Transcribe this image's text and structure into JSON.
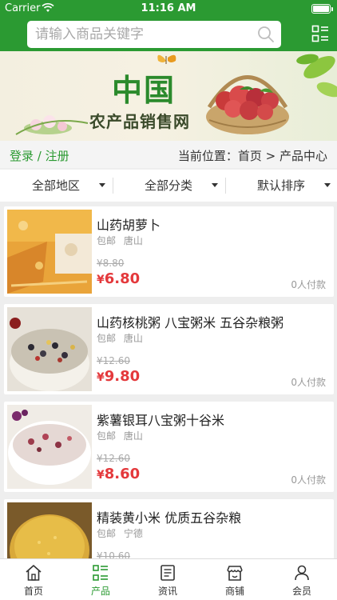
{
  "status_bar": {
    "carrier": "Carrier",
    "time": "11:16 AM"
  },
  "header": {
    "search_placeholder": "请输入商品关键字",
    "search_icon": "search-icon",
    "menu_icon": "grid-list-icon"
  },
  "banner": {
    "title": "中国",
    "subtitle": "农产品销售网"
  },
  "breadcrumb": {
    "login": "登录",
    "separator": "/",
    "register": "注册",
    "location": "当前位置：首页 > 产品中心"
  },
  "filters": [
    {
      "label": "全部地区"
    },
    {
      "label": "全部分类"
    },
    {
      "label": "默认排序"
    }
  ],
  "products": [
    {
      "name": "山药胡萝卜",
      "shipping": "包邮",
      "city": "唐山",
      "old_price": "¥8.80",
      "price_symbol": "¥",
      "price": "6.80",
      "sold": "0人付款"
    },
    {
      "name": "山药核桃粥 八宝粥米 五谷杂粮粥",
      "shipping": "包邮",
      "city": "唐山",
      "old_price": "¥12.60",
      "price_symbol": "¥",
      "price": "9.80",
      "sold": "0人付款"
    },
    {
      "name": "紫薯银耳八宝粥十谷米",
      "shipping": "包邮",
      "city": "唐山",
      "old_price": "¥12.60",
      "price_symbol": "¥",
      "price": "8.60",
      "sold": "0人付款"
    },
    {
      "name": "精装黄小米 优质五谷杂粮",
      "shipping": "包邮",
      "city": "宁德",
      "old_price": "¥10.60",
      "price_symbol": "¥",
      "price": "",
      "sold": ""
    }
  ],
  "tabs": [
    {
      "label": "首页",
      "icon": "home-icon",
      "active": false
    },
    {
      "label": "产品",
      "icon": "product-list-icon",
      "active": true
    },
    {
      "label": "资讯",
      "icon": "news-icon",
      "active": false
    },
    {
      "label": "商铺",
      "icon": "store-icon",
      "active": false
    },
    {
      "label": "会员",
      "icon": "member-icon",
      "active": false
    }
  ],
  "colors": {
    "brand_green": "#2b9a32",
    "price_red": "#e4393c",
    "background": "#eeeeee"
  }
}
